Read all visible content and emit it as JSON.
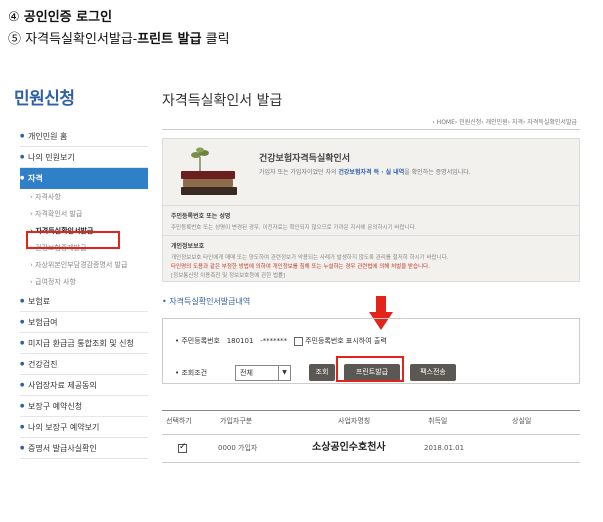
{
  "instructions": {
    "step1_num": "④",
    "step1_text": "공인인증 로그인",
    "step2_num": "⑤",
    "step2_prefix": "자격득실확인서발급-",
    "step2_bold": "프린트 발급",
    "step2_suffix": " 클릭"
  },
  "colors": {
    "accent": "#2f7fc9",
    "brand_text": "#2f5fa7",
    "highlight_box": "#e3241b",
    "button_dark": "#5b5753"
  },
  "logo": "민원신청",
  "sidebar": {
    "items": [
      {
        "label": "개인민원 홈"
      },
      {
        "label": "나의 민원보기"
      },
      {
        "label": "자격",
        "active": true
      }
    ],
    "sub_items": [
      {
        "label": "자격사항"
      },
      {
        "label": "자격확인서 발급"
      },
      {
        "label": "자격득실확인서발급",
        "current": true
      },
      {
        "label": "건강보험증재발급"
      },
      {
        "label": "자상위본인부담경감증명서 발급"
      },
      {
        "label": "급여정지 사항"
      }
    ],
    "items_after": [
      {
        "label": "보험료"
      },
      {
        "label": "보험급여"
      },
      {
        "label": "미지급 환급금 통합조회 및 신청"
      },
      {
        "label": "건강검진"
      },
      {
        "label": "사업장자료 제공동의"
      },
      {
        "label": "보장구 예약신청"
      },
      {
        "label": "나의 보장구 예약보기"
      },
      {
        "label": "증명서 발급사실확인"
      }
    ]
  },
  "main": {
    "title": "자격득실확인서 발급",
    "breadcrumb": "› HOME› 민원신청› 개인민원› 자격› 자격득실확인서발급",
    "info_title": "건강보험자격득실확인서",
    "info_desc_prefix": "가입자 또는 가입자이었던 자의 ",
    "info_desc_bold": "건강보험자격 득 · 실 내역",
    "info_desc_suffix": "을 확인하는 증명서입니다.",
    "section1_heading": "주민등록번호 또는 성명",
    "section1_text": "주민등록번호 또는 성명이 변경된 경우, 이전자료는 확인되지 않으므로 가까운 지사에 문의하시기 바랍니다.",
    "section2_heading": "개인정보보호",
    "section2_line1": "개인정보보호 타인에게 매매 또는 양도하여 관련정보가 악용되는 사례가 발생하지 않도록 관리를 철저히 하시기 바랍니다.",
    "section2_line2": "타인명의 도용과 같은 부정한 방법에 의하여 개인정보를 침해 또는 누설하는 경우 관련법에 의해 처벌을 받습니다.",
    "section2_line3": "[정보통신망 이용촉진 및 정보보호등에 관한 법률]",
    "form_section_title": "자격득실확인서발급내역",
    "form": {
      "rrn_label": "주민등록번호",
      "rrn_front": "180101",
      "rrn_back": "-*******",
      "rrn_checkbox_label": "주민등록번호 표시하여 출력",
      "period_label": "조회조건",
      "period_value": "전체",
      "search_button": "조회",
      "print_button": "프린트발급",
      "fax_button": "팩스전송"
    },
    "table": {
      "headers": [
        "선택하기",
        "가입자구분",
        "사업자명칭",
        "취득일",
        "상실일"
      ],
      "rows": [
        {
          "type": "0000 가입자",
          "company": "소상공인수호천사",
          "acquired": "2018.01.01",
          "lost": ""
        }
      ]
    }
  }
}
